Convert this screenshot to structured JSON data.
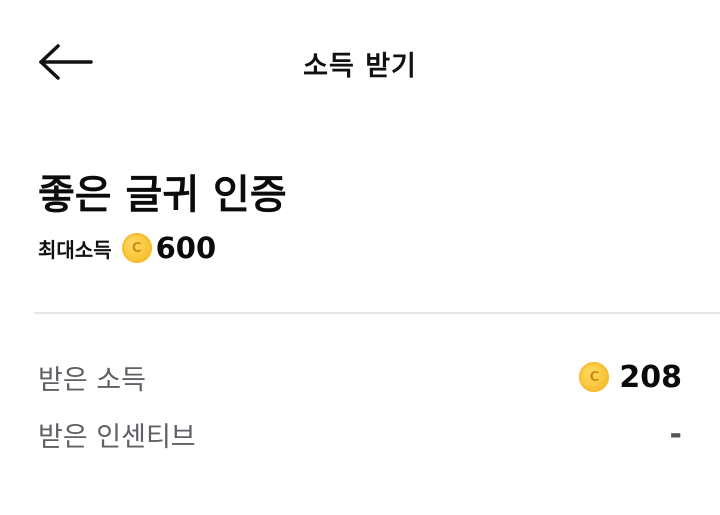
{
  "header": {
    "title": "소득 받기",
    "back_icon": "arrow-left-icon"
  },
  "card": {
    "title": "좋은 글귀 인증",
    "max_label": "최대소득",
    "coin_letter": "C",
    "max_value": "600"
  },
  "rows": {
    "received_income": {
      "label": "받은 소득",
      "value": "208"
    },
    "received_incentive": {
      "label": "받은 인센티브",
      "value": "-"
    }
  },
  "colors": {
    "coin": "#f8c437",
    "text_primary": "#0b0b0b",
    "text_secondary": "#5f5f66",
    "divider": "#e6e6ea"
  }
}
